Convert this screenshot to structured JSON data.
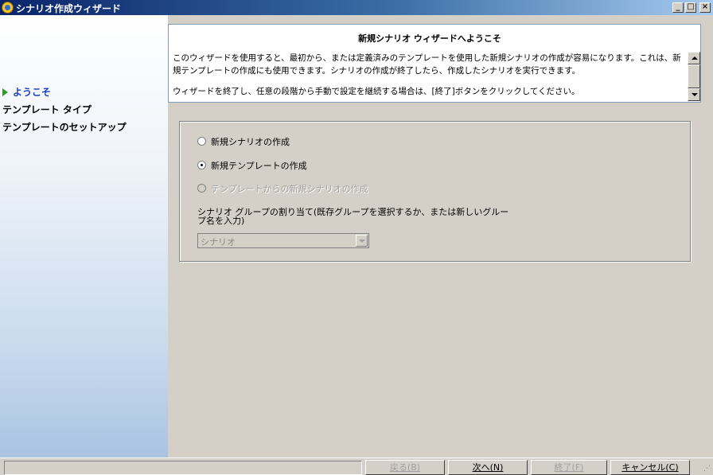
{
  "window": {
    "title": "シナリオ作成ウィザード",
    "minimize": "_",
    "maximize": "□",
    "close": "×"
  },
  "nav": {
    "items": [
      {
        "label": "ようこそ",
        "active": true
      },
      {
        "label": "テンプレート タイプ",
        "active": false
      },
      {
        "label": "テンプレートのセットアップ",
        "active": false
      }
    ]
  },
  "header": {
    "title": "新規シナリオ ウィザードへようこそ",
    "desc1": "このウィザードを使用すると、最初から、または定義済みのテンプレートを使用した新規シナリオの作成が容易になります。これは、新規テンプレートの作成にも使用できます。シナリオの作成が終了したら、作成したシナリオを実行できます。",
    "desc2": "ウィザードを終了し、任意の段階から手動で設定を継続する場合は、[終了]ボタンをクリックしてください。"
  },
  "options": {
    "radio1": "新規シナリオの作成",
    "radio2": "新規テンプレートの作成",
    "radio3": "テンプレートからの新規シナリオの作成",
    "selected": "radio2",
    "group_label": "シナリオ グループの割り当て(既存グループを選択するか、または新しいグループ名を入力)",
    "group_value": "シナリオ"
  },
  "buttons": {
    "back": "戻る(B)",
    "next": "次へ(N)",
    "finish": "終了(F)",
    "cancel": "キャンセル(C)"
  }
}
